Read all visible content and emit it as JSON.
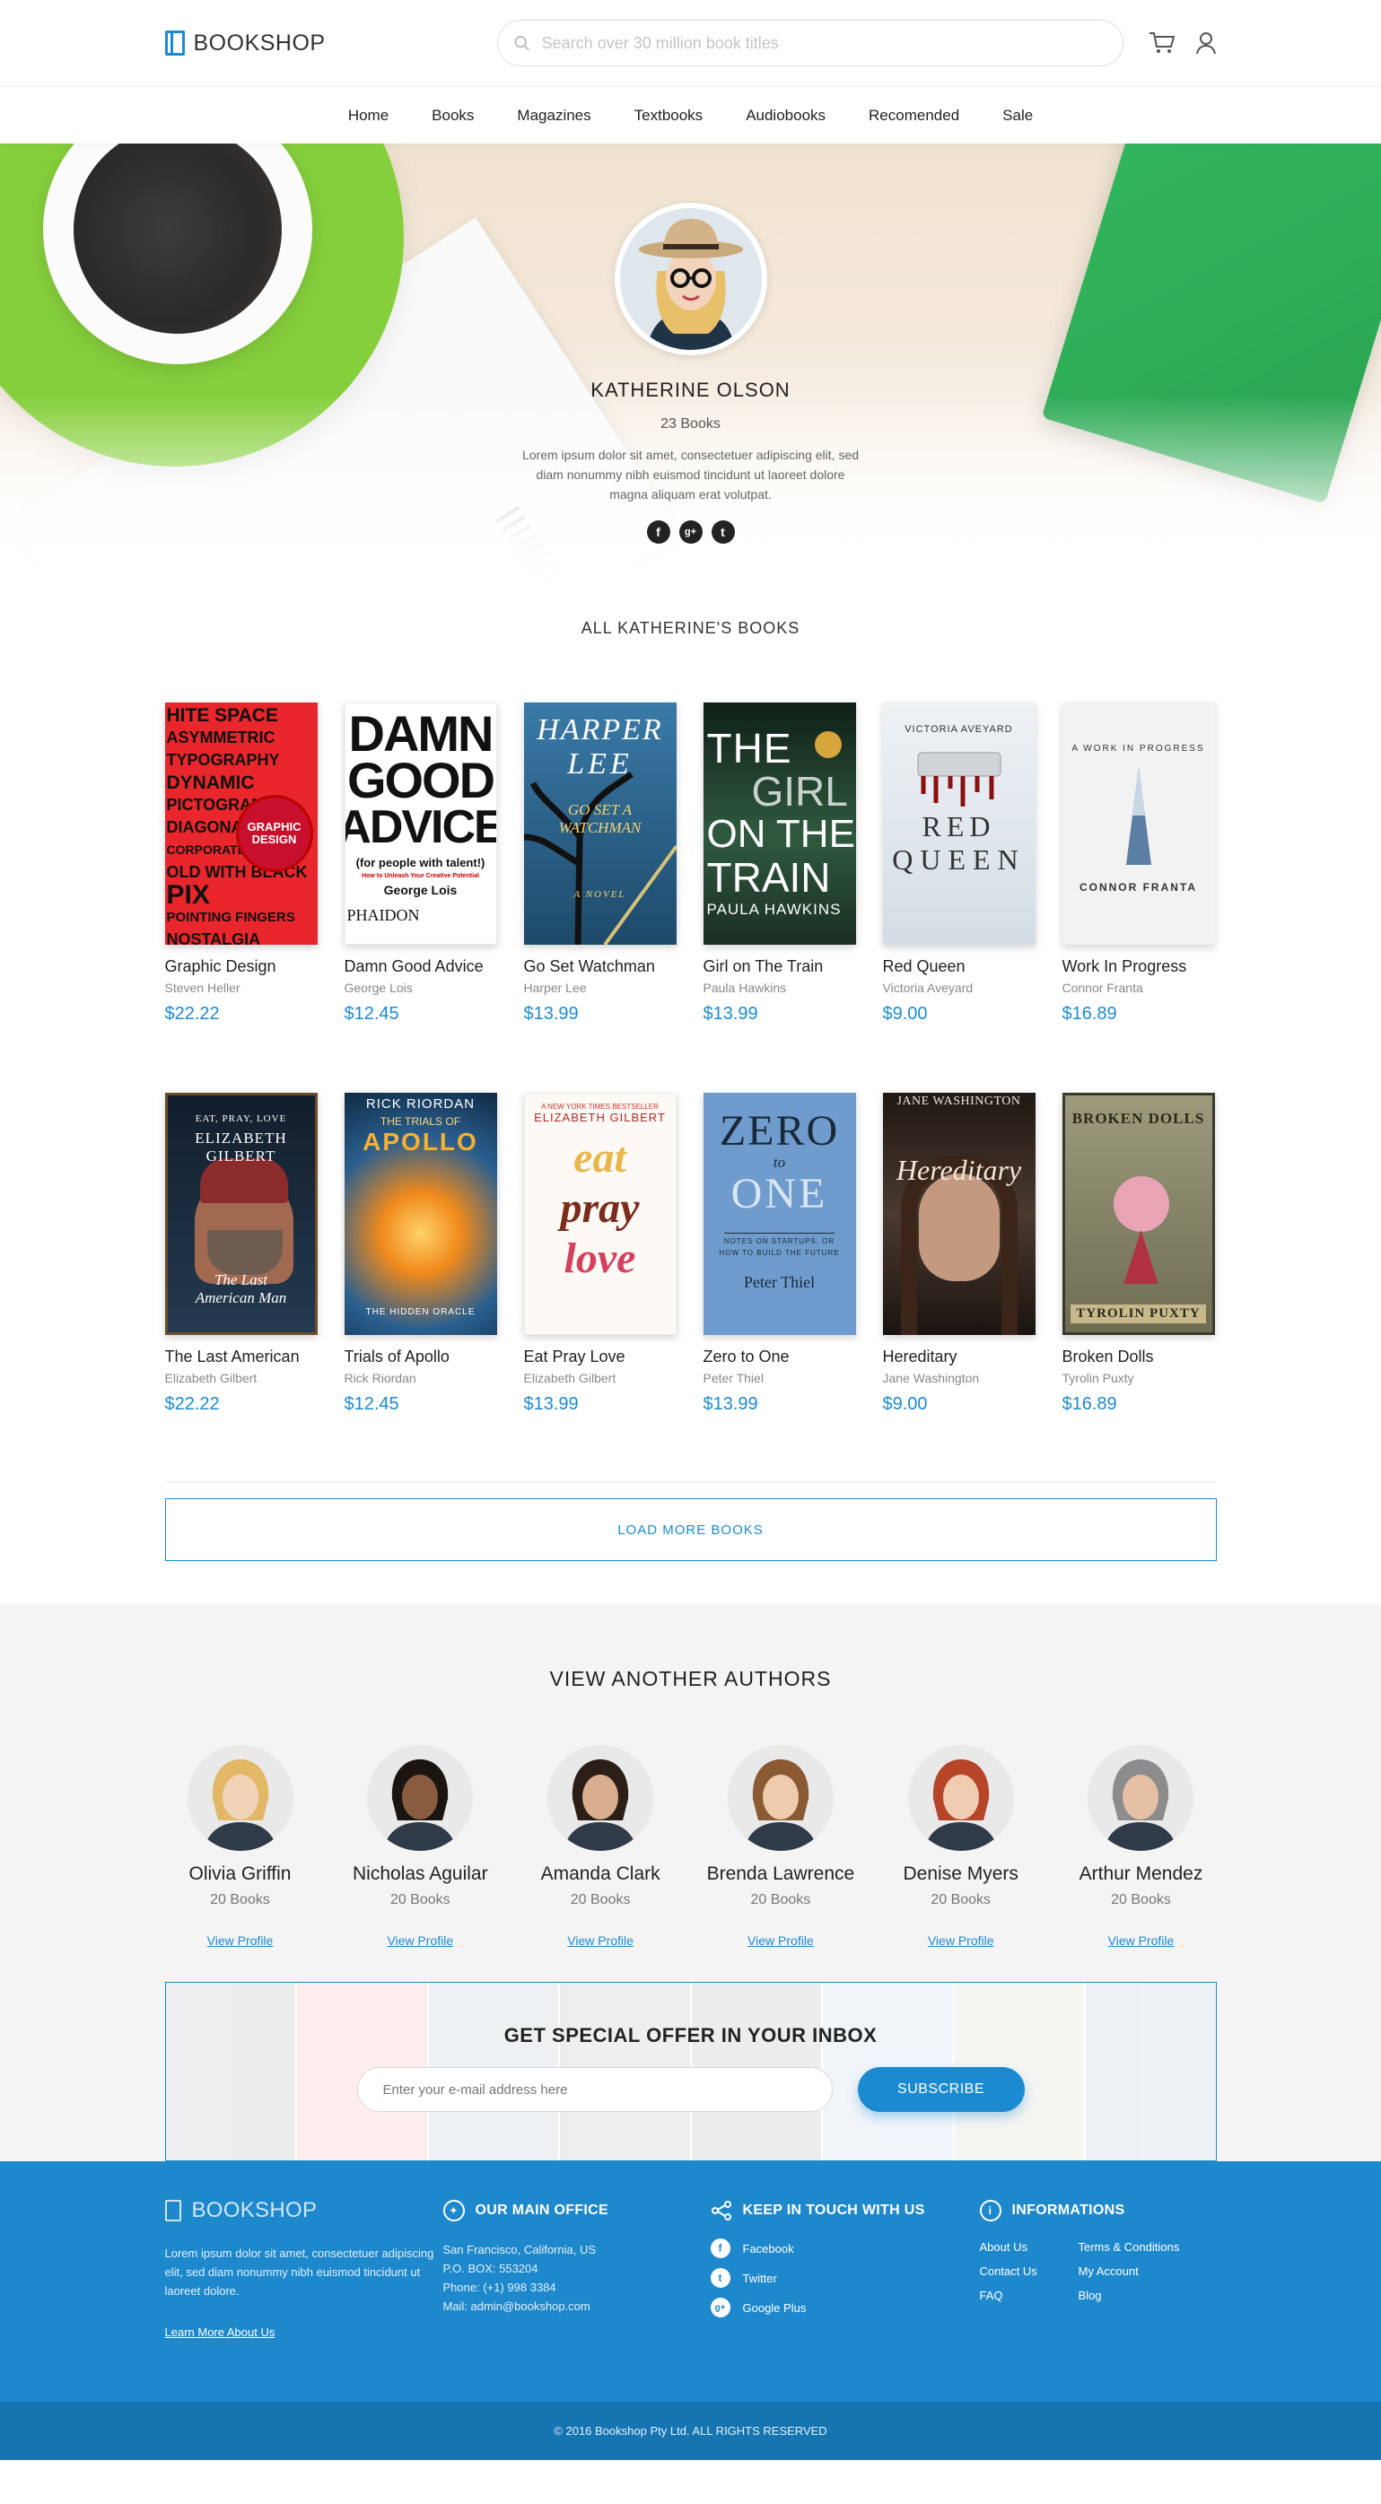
{
  "header": {
    "logo": "BOOKSHOP",
    "search_placeholder": "Search over 30 million book titles"
  },
  "nav": [
    "Home",
    "Books",
    "Magazines",
    "Textbooks",
    "Audiobooks",
    "Recomended",
    "Sale"
  ],
  "author": {
    "name": "KATHERINE OLSON",
    "count": "23 Books",
    "bio": "Lorem ipsum dolor sit amet, consectetuer adipiscing elit, sed diam nonummy nibh euismod tincidunt ut laoreet dolore magna aliquam erat volutpat.",
    "social": [
      "f",
      "g+",
      "t"
    ]
  },
  "books_title": "ALL KATHERINE'S BOOKS",
  "books": [
    {
      "title": "Graphic Design",
      "author": "Steven Heller",
      "price": "$22.22",
      "color": "#e8262b"
    },
    {
      "title": "Damn Good Advice",
      "author": "George Lois",
      "price": "$12.45",
      "color": "#ffffff"
    },
    {
      "title": "Go Set Watchman",
      "author": "Harper Lee",
      "price": "$13.99",
      "color": "#2a5b7c"
    },
    {
      "title": "Girl on The Train",
      "author": "Paula Hawkins",
      "price": "$13.99",
      "color": "#1d3a2b"
    },
    {
      "title": "Red Queen",
      "author": "Victoria Aveyard",
      "price": "$9.00",
      "color": "#dfe7ee"
    },
    {
      "title": "Work In Progress",
      "author": "Connor Franta",
      "price": "$16.89",
      "color": "#efefef"
    },
    {
      "title": "The Last American",
      "author": "Elizabeth Gilbert",
      "price": "$22.22",
      "color": "#1d2b3a"
    },
    {
      "title": "Trials of Apollo",
      "author": "Rick Riordan",
      "price": "$12.45",
      "color": "#1d5a8a"
    },
    {
      "title": "Eat Pray Love",
      "author": "Elizabeth Gilbert",
      "price": "$13.99",
      "color": "#fdfaf5"
    },
    {
      "title": "Zero to One",
      "author": "Peter Thiel",
      "price": "$13.99",
      "color": "#5e8fc4"
    },
    {
      "title": "Hereditary",
      "author": "Jane Washington",
      "price": "$9.00",
      "color": "#3a2e28"
    },
    {
      "title": "Broken Dolls",
      "author": "Tyrolin Puxty",
      "price": "$16.89",
      "color": "#8b8a6c"
    }
  ],
  "covers": {
    "graphic": [
      "HITE SPACE",
      "DYNAMIC",
      "PICTOGRAMS",
      "GRAPHIC",
      "DESIGN",
      "NOSTALGIA"
    ],
    "damn": [
      "DAMN",
      "GOOD",
      "ADVICE",
      "(for people with talent!)",
      "George Lois",
      "PHAIDON"
    ],
    "harper": [
      "HARPER",
      "LEE",
      "GO SET A",
      "WATCHMAN",
      "A NOVEL"
    ],
    "train": [
      "THE",
      "GIRL",
      "ON THE",
      "TRAIN",
      "PAULA HAWKINS"
    ],
    "red": [
      "VICTORIA AVEYARD",
      "RED",
      "QUEEN"
    ],
    "wip": [
      "A WORK IN PROGRESS",
      "CONNOR FRANTA"
    ],
    "last": [
      "EAT, PRAY, LOVE",
      "ELIZABETH",
      "GILBERT",
      "The Last",
      "American Man"
    ],
    "apollo": [
      "RICK RIORDAN",
      "THE TRIALS OF",
      "APOLLO",
      "THE HIDDEN ORACLE"
    ],
    "eat": [
      "ELIZABETH GILBERT",
      "eat",
      "pray",
      "love"
    ],
    "zero": [
      "ZERO",
      "to",
      "ONE",
      "NOTES ON STARTUPS, OR",
      "HOW TO BUILD THE FUTURE",
      "Peter Thiel"
    ],
    "hered": [
      "JANE WASHINGTON",
      "Hereditary"
    ],
    "dolls": [
      "BROKEN DOLLS",
      "TYROLIN PUXTY"
    ]
  },
  "load_more": "LOAD MORE BOOKS",
  "authors_title": "VIEW ANOTHER AUTHORS",
  "authors": [
    {
      "name": "Olivia Griffin",
      "count": "20 Books",
      "link": "View Profile",
      "skin": "#f1d3b8",
      "hair": "#e2b867"
    },
    {
      "name": "Nicholas Aguilar",
      "count": "20 Books",
      "link": "View Profile",
      "skin": "#8a5c3f",
      "hair": "#1b1512"
    },
    {
      "name": "Amanda Clark",
      "count": "20 Books",
      "link": "View Profile",
      "skin": "#d9ae8e",
      "hair": "#2a1e17"
    },
    {
      "name": "Brenda Lawrence",
      "count": "20 Books",
      "link": "View Profile",
      "skin": "#efcbad",
      "hair": "#8a5a34"
    },
    {
      "name": "Denise Myers",
      "count": "20 Books",
      "link": "View Profile",
      "skin": "#f0cdb2",
      "hair": "#b6452a"
    },
    {
      "name": "Arthur Mendez",
      "count": "20 Books",
      "link": "View Profile",
      "skin": "#e6c0a4",
      "hair": "#8c8c8c"
    }
  ],
  "newsletter": {
    "title": "GET SPECIAL OFFER IN YOUR INBOX",
    "placeholder": "Enter your e-mail address here",
    "button": "SUBSCRIBE"
  },
  "footer": {
    "about": {
      "logo": "BOOKSHOP",
      "text": "Lorem ipsum dolor sit amet, consectetuer adipiscing elit, sed diam nonummy nibh euismod tincidunt ut laoreet dolore.",
      "link": "Learn More About Us"
    },
    "office": {
      "title": "OUR MAIN OFFICE",
      "lines": [
        "San Francisco, California, US",
        "P.O. BOX: 553204",
        "Phone: (+1) 998 3384",
        "Mail: admin@bookshop.com"
      ]
    },
    "social": {
      "title": "KEEP IN TOUCH WITH US",
      "items": [
        {
          "icon": "f",
          "label": "Facebook"
        },
        {
          "icon": "t",
          "label": "Twitter"
        },
        {
          "icon": "g+",
          "label": "Google Plus"
        }
      ]
    },
    "info": {
      "title": "INFORMATIONS",
      "links": [
        "About Us",
        "Terms & Conditions",
        "Contact Us",
        "My Account",
        "FAQ",
        "Blog"
      ]
    },
    "copyright": "© 2016 Bookshop Pty Ltd. ALL RIGHTS RESERVED"
  },
  "colors": {
    "accent": "#1b8ad1",
    "footer": "#1e88cc",
    "footer_bottom": "#1674b1"
  }
}
